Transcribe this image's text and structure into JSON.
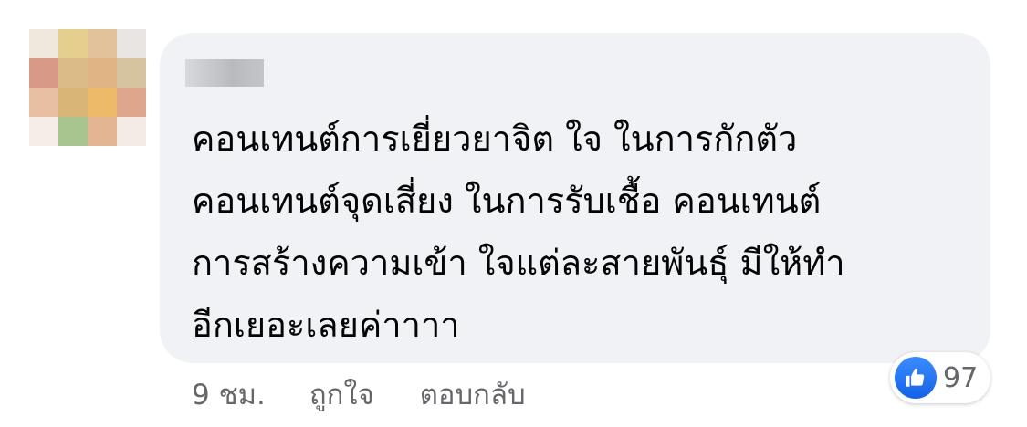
{
  "comment": {
    "lines": [
      "คอนเทนต์การเยี่ยวยาจิต ใจ ในการกักตัว",
      "คอนเทนต์จุดเสี่ยง ในการรับเชื้อ คอนเทนต์",
      "การสร้างความเข้า ใจแต่ละสายพันธุ์ มีให้ทำ",
      "อีกเยอะเลยค่าาาา"
    ]
  },
  "actions": {
    "timestamp": "9 ชม.",
    "like_label": "ถูกใจ",
    "reply_label": "ตอบกลับ"
  },
  "reactions": {
    "icon": "like-thumbs-up-icon",
    "count": "97",
    "accent": "#1877f2"
  }
}
